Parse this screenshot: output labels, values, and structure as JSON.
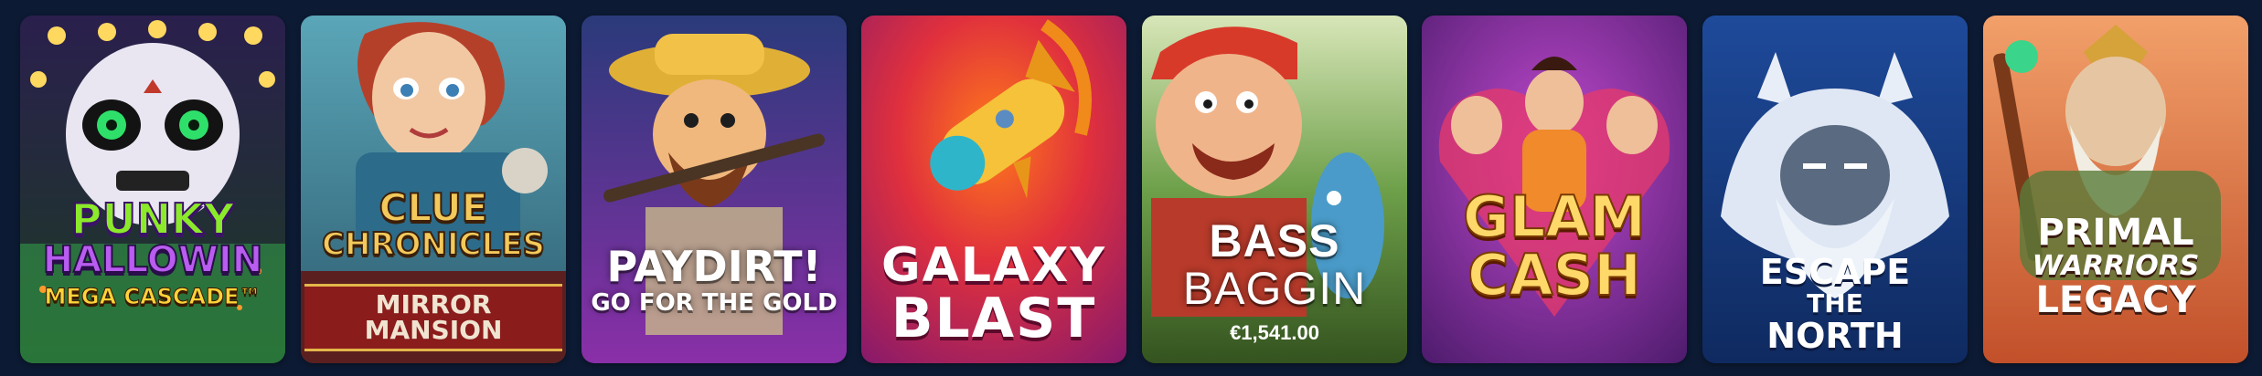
{
  "games": [
    {
      "id": "punky",
      "title_lines": [
        "PUNKY",
        "HALLOWIN",
        "MEGA CASCADE™"
      ]
    },
    {
      "id": "clue",
      "title_lines": [
        "CLUE",
        "CHRONICLES",
        "MIRROR MANSION"
      ]
    },
    {
      "id": "paydirt",
      "title_lines": [
        "PAYDIRT!",
        "GO FOR THE GOLD"
      ]
    },
    {
      "id": "galaxy",
      "title_lines": [
        "GALAXY",
        "BLAST"
      ]
    },
    {
      "id": "bass",
      "title_lines": [
        "BASS",
        "BAGGIN"
      ],
      "jackpot": "€1,541.00"
    },
    {
      "id": "glam",
      "title_lines": [
        "GLAM",
        "CASH"
      ]
    },
    {
      "id": "escape",
      "title_lines": [
        "ESCAPE",
        "THE",
        "NORTH"
      ]
    },
    {
      "id": "primal",
      "title_lines": [
        "PRIMAL",
        "WARRIORS",
        "LEGACY"
      ]
    }
  ],
  "colors": {
    "page_bg": "#0c1a33",
    "punky": "#3a2a5a",
    "clue": "#3f7f9a",
    "paydirt": "#4a2d7a",
    "galaxy": "#c2185b",
    "bass": "#6a9a3a",
    "glam": "#8e2a9a",
    "escape": "#1a3a7a",
    "primal": "#e0784a"
  }
}
